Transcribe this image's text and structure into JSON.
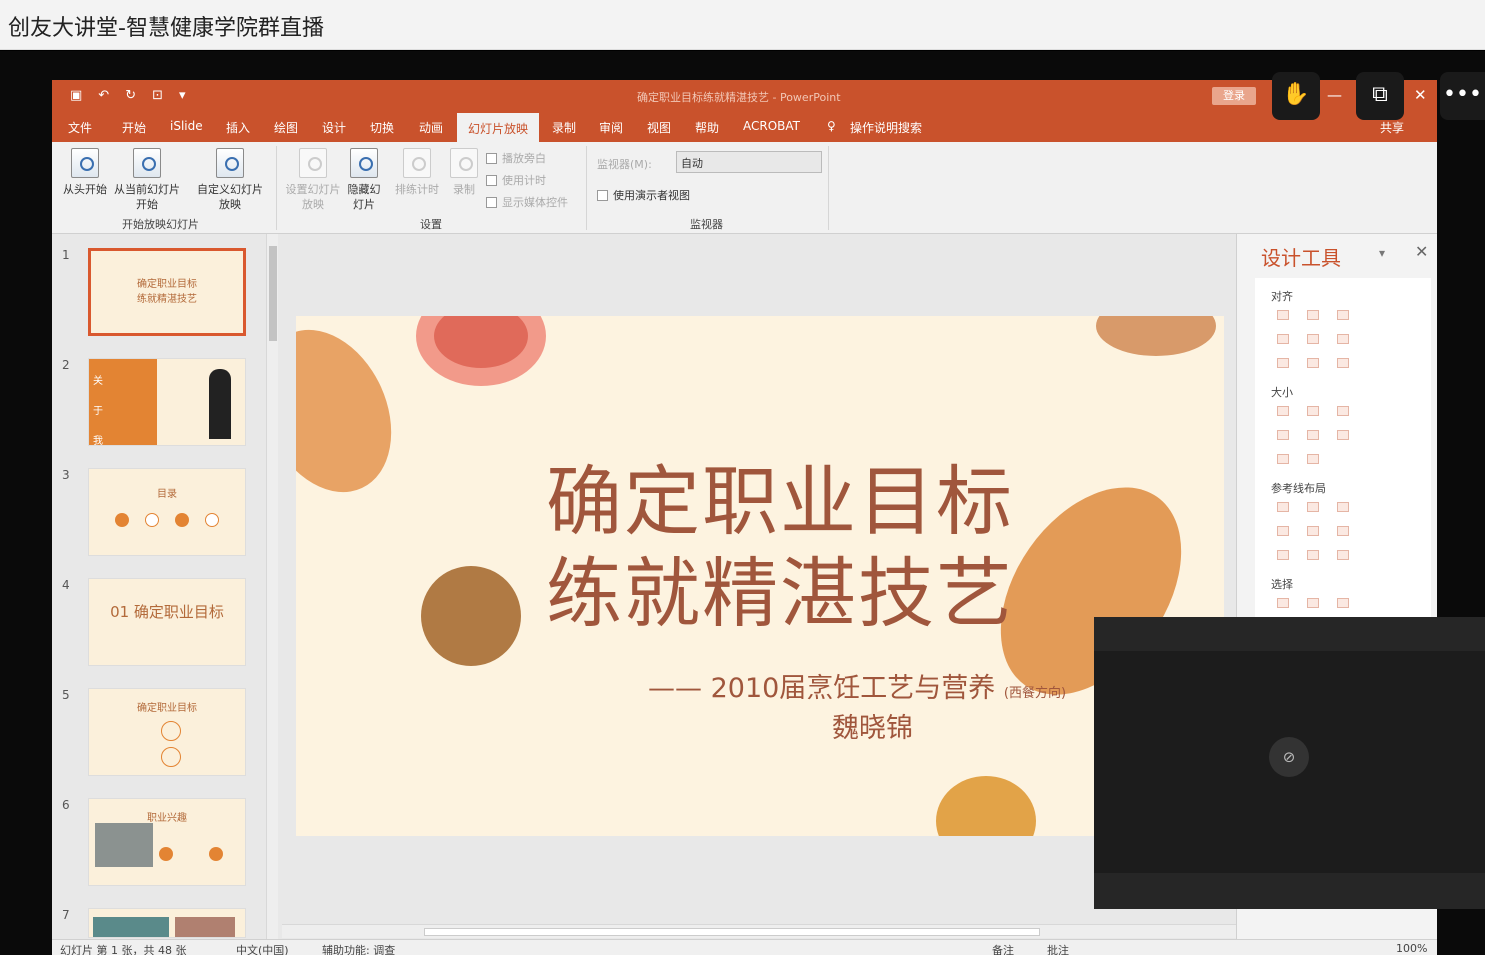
{
  "window": {
    "title": "创友大讲堂-智慧健康学院群直播"
  },
  "ppt": {
    "doc_title": "确定职业目标练就精湛技艺 - PowerPoint",
    "login_label": "登录",
    "share_label": "共享",
    "tabs": [
      "文件",
      "开始",
      "iSlide",
      "插入",
      "绘图",
      "设计",
      "切换",
      "动画",
      "幻灯片放映",
      "录制",
      "审阅",
      "视图",
      "帮助",
      "ACROBAT",
      "操作说明搜索"
    ],
    "active_tab": "幻灯片放映",
    "ribbon": {
      "from_start": "从头开始",
      "from_current": "从当前幻灯片开始",
      "custom_show": "自定义幻灯片放映",
      "group_start": "开始放映幻灯片",
      "setup_show": "设置幻灯片放映",
      "hide_slide": "隐藏幻灯片",
      "rehearse": "排练计时",
      "record": "录制",
      "play_narration": "播放旁白",
      "use_timings": "使用计时",
      "show_media_controls": "显示媒体控件",
      "group_setup": "设置",
      "monitor_label": "监视器(M):",
      "monitor_value": "自动",
      "presenter_view": "使用演示者视图",
      "group_monitors": "监视器"
    },
    "thumbnails": [
      {
        "num": "1",
        "title": "确定职业目标\n练就精湛技艺",
        "selected": true
      },
      {
        "num": "2",
        "title": "关于我",
        "selected": false
      },
      {
        "num": "3",
        "title": "目录",
        "selected": false
      },
      {
        "num": "4",
        "title": "01 确定职业目标",
        "selected": false
      },
      {
        "num": "5",
        "title": "确定职业目标",
        "selected": false
      },
      {
        "num": "6",
        "title": "职业兴趣",
        "selected": false
      },
      {
        "num": "7",
        "title": "",
        "selected": false
      }
    ],
    "slide": {
      "title_line1": "确定职业目标",
      "title_line2": "练就精湛技艺",
      "subtitle": "—— 2010届烹饪工艺与营养",
      "subtitle_note": "(西餐方向)",
      "author": "魏晓锦"
    },
    "design_pane": {
      "title": "设计工具",
      "sections": [
        "对齐",
        "大小",
        "参考线布局",
        "选择"
      ]
    },
    "status": {
      "slide_info": "幻灯片 第 1 张，共 48 张",
      "language": "中文(中国)",
      "accessibility": "辅助功能: 调查",
      "notes": "备注",
      "comments": "批注",
      "zoom": "100%"
    }
  },
  "colors": {
    "accent": "#c9522c",
    "slide_text": "#a0563c",
    "slide_bg": "#fdf3e0"
  },
  "icons": [
    "hand-raise-icon",
    "share-screen-icon",
    "more-icon",
    "camera-off-icon"
  ]
}
